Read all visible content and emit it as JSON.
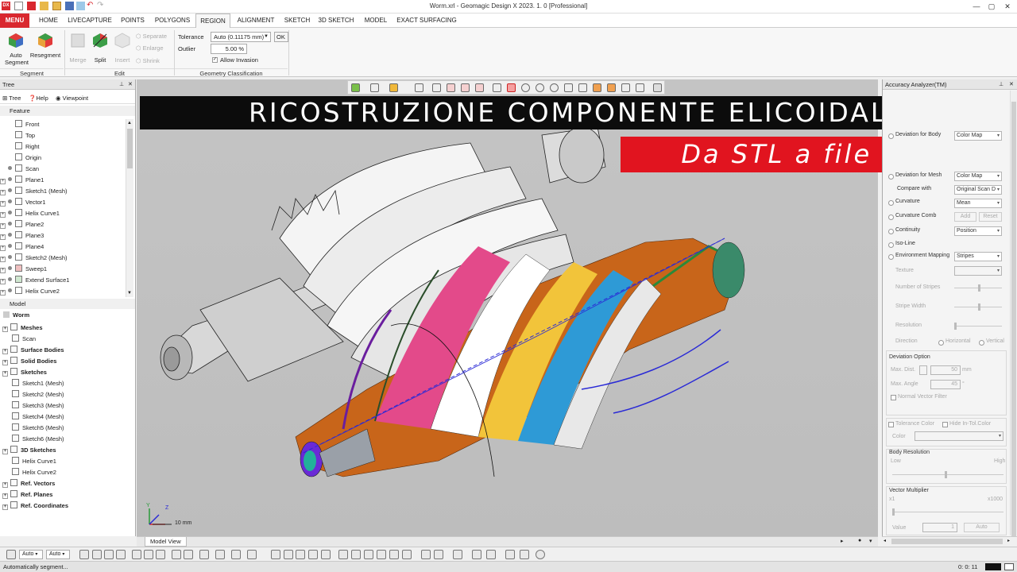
{
  "app": {
    "title": "Worm.xrl - Geomagic Design X 2023. 1. 0 [Professional]",
    "logo": "DX"
  },
  "menu_tabs": [
    "MENU",
    "HOME",
    "LIVECAPTURE",
    "POINTS",
    "POLYGONS",
    "REGION",
    "ALIGNMENT",
    "SKETCH",
    "3D SKETCH",
    "MODEL",
    "EXACT SURFACING"
  ],
  "active_tab": "REGION",
  "ribbon": {
    "segment": {
      "label": "Segment",
      "auto_segment": "Auto Segment",
      "resegment": "Resegment"
    },
    "edit": {
      "label": "Edit",
      "merge": "Merge",
      "split": "Split",
      "insert": "Insert",
      "separate": "Separate",
      "enlarge": "Enlarge",
      "shrink": "Shrink"
    },
    "geometry": {
      "label": "Geometry Classification",
      "tolerance_label": "Tolerance",
      "tolerance_value": "Auto (0.11175 mm)",
      "ok": "OK",
      "outlier_label": "Outlier",
      "outlier_value": "5.00 %",
      "allow_invasion": "Allow Invasion"
    }
  },
  "tree_panel": {
    "title": "Tree",
    "tabs": [
      "Tree",
      "Help",
      "Viewpoint"
    ],
    "feature_label": "Feature",
    "features": [
      {
        "label": "Front",
        "kind": "plane"
      },
      {
        "label": "Top",
        "kind": "plane"
      },
      {
        "label": "Right",
        "kind": "plane"
      },
      {
        "label": "Origin",
        "kind": "origin"
      },
      {
        "label": "Scan",
        "kind": "mesh"
      },
      {
        "label": "Plane1",
        "kind": "plane"
      },
      {
        "label": "Sketch1 (Mesh)",
        "kind": "sketch"
      },
      {
        "label": "Vector1",
        "kind": "vector"
      },
      {
        "label": "Helix Curve1",
        "kind": "curve"
      },
      {
        "label": "Plane2",
        "kind": "plane"
      },
      {
        "label": "Plane3",
        "kind": "plane"
      },
      {
        "label": "Plane4",
        "kind": "plane"
      },
      {
        "label": "Sketch2 (Mesh)",
        "kind": "sketch"
      },
      {
        "label": "Sweep1",
        "kind": "solid"
      },
      {
        "label": "Extend Surface1",
        "kind": "surface"
      },
      {
        "label": "Helix Curve2",
        "kind": "curve"
      }
    ],
    "model_label": "Model",
    "model_root": "Worm",
    "model_items": [
      {
        "label": "Meshes",
        "bold": true,
        "level": 0
      },
      {
        "label": "Scan",
        "bold": false,
        "level": 1
      },
      {
        "label": "Surface Bodies",
        "bold": true,
        "level": 0
      },
      {
        "label": "Solid Bodies",
        "bold": true,
        "level": 0
      },
      {
        "label": "Sketches",
        "bold": true,
        "level": 0
      },
      {
        "label": "Sketch1 (Mesh)",
        "bold": false,
        "level": 1
      },
      {
        "label": "Sketch2 (Mesh)",
        "bold": false,
        "level": 1
      },
      {
        "label": "Sketch3 (Mesh)",
        "bold": false,
        "level": 1
      },
      {
        "label": "Sketch4 (Mesh)",
        "bold": false,
        "level": 1
      },
      {
        "label": "Sketch5 (Mesh)",
        "bold": false,
        "level": 1
      },
      {
        "label": "Sketch6 (Mesh)",
        "bold": false,
        "level": 1
      },
      {
        "label": "3D Sketches",
        "bold": true,
        "level": 0
      },
      {
        "label": "Helix Curve1",
        "bold": false,
        "level": 1
      },
      {
        "label": "Helix Curve2",
        "bold": false,
        "level": 1
      },
      {
        "label": "Ref. Vectors",
        "bold": true,
        "level": 0
      },
      {
        "label": "Ref. Planes",
        "bold": true,
        "level": 0
      },
      {
        "label": "Ref. Coordinates",
        "bold": true,
        "level": 0
      }
    ]
  },
  "viewport": {
    "banner_title": "RICOSTRUZIONE COMPONENTE ELICOIDALE",
    "banner_subtitle": "Da STL a file STEP",
    "scale_label": "10 mm",
    "axis_y": "Y",
    "axis_z": "Z",
    "tab_label": "Model View",
    "colors": {
      "banner_red": "#e1141f",
      "banner_black": "#0c0c0c",
      "background": "#c0c0c0"
    }
  },
  "accuracy_panel": {
    "title": "Accuracy Analyzer(TM)",
    "rows": [
      {
        "label": "Deviation for Body",
        "value": "Color Map"
      },
      {
        "label": "Deviation for Mesh",
        "value": "Color Map"
      },
      {
        "label": "Compare with",
        "value": "Original Scan D"
      },
      {
        "label": "Curvature",
        "value": "Mean"
      },
      {
        "label": "Curvature Comb",
        "value": ""
      },
      {
        "label": "Continuity",
        "value": "Position"
      },
      {
        "label": "Iso-Line",
        "value": ""
      },
      {
        "label": "Environment Mapping",
        "value": "Stripes"
      }
    ],
    "add": "Add",
    "reset": "Reset",
    "texture": "Texture",
    "number_of_stripes": "Number of Stripes",
    "stripe_width": "Stripe Width",
    "resolution": "Resolution",
    "direction": "Direction",
    "horizontal": "Horizontal",
    "vertical": "Vertical",
    "deviation_option": "Deviation Option",
    "max_dist": "Max. Dist.",
    "max_dist_value": "50",
    "max_dist_unit": "mm",
    "max_angle": "Max. Angle",
    "max_angle_value": "45",
    "max_angle_unit": "°",
    "normal_vector_filter": "Normal Vector Filter",
    "tolerance_color": "Tolerance Color",
    "hide_in_tol": "Hide In-Tol.Color",
    "color": "Color",
    "body_resolution": "Body Resolution",
    "low": "Low",
    "high": "High",
    "vector_multiplier": "Vector Multiplier",
    "x1": "x1",
    "x1000": "x1000",
    "value": "Value",
    "value_num": "1",
    "auto": "Auto"
  },
  "bottom": {
    "combo1": "Auto",
    "combo2": "Auto"
  },
  "status": {
    "message": "Automatically segment...",
    "time": "0: 0: 11"
  }
}
